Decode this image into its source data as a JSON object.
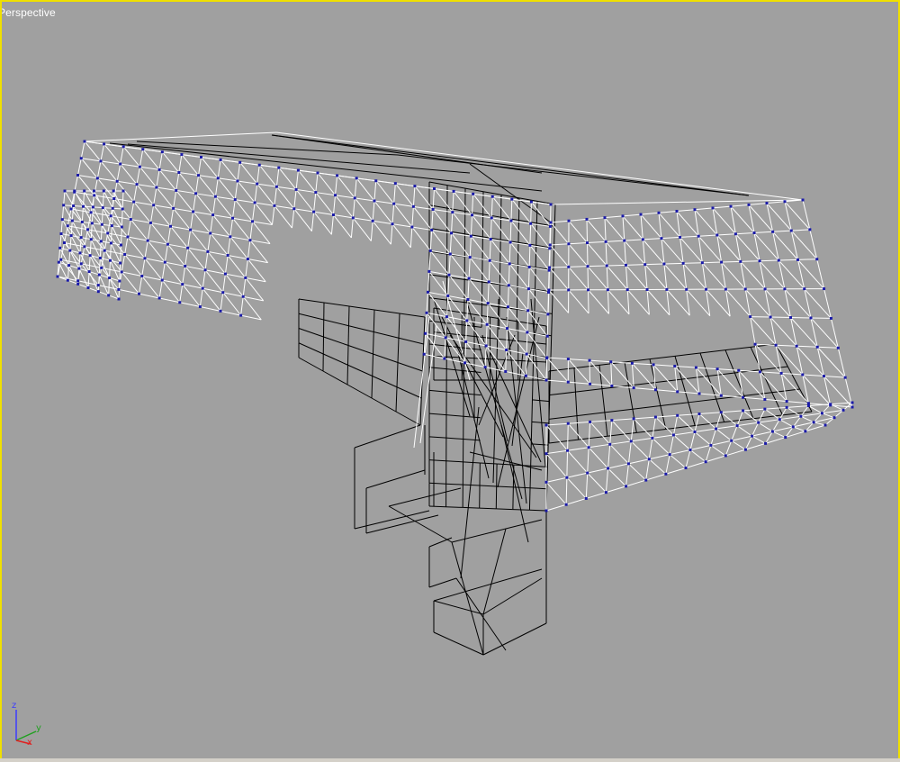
{
  "viewport": {
    "label": "Perspective",
    "border_color": "#f0e000",
    "background_color": "#a0a0a0"
  },
  "axis_tripod": {
    "z_label": "z",
    "y_label": "y",
    "x_label": "x",
    "z_color": "#3c3cff",
    "y_color": "#20a020",
    "x_color": "#e02020"
  },
  "scene": {
    "description_icon": "wireframe-model",
    "selected_wire_color": "#ffffff",
    "unselected_wire_color": "#000000",
    "vertex_color": "#1a1aa8"
  }
}
